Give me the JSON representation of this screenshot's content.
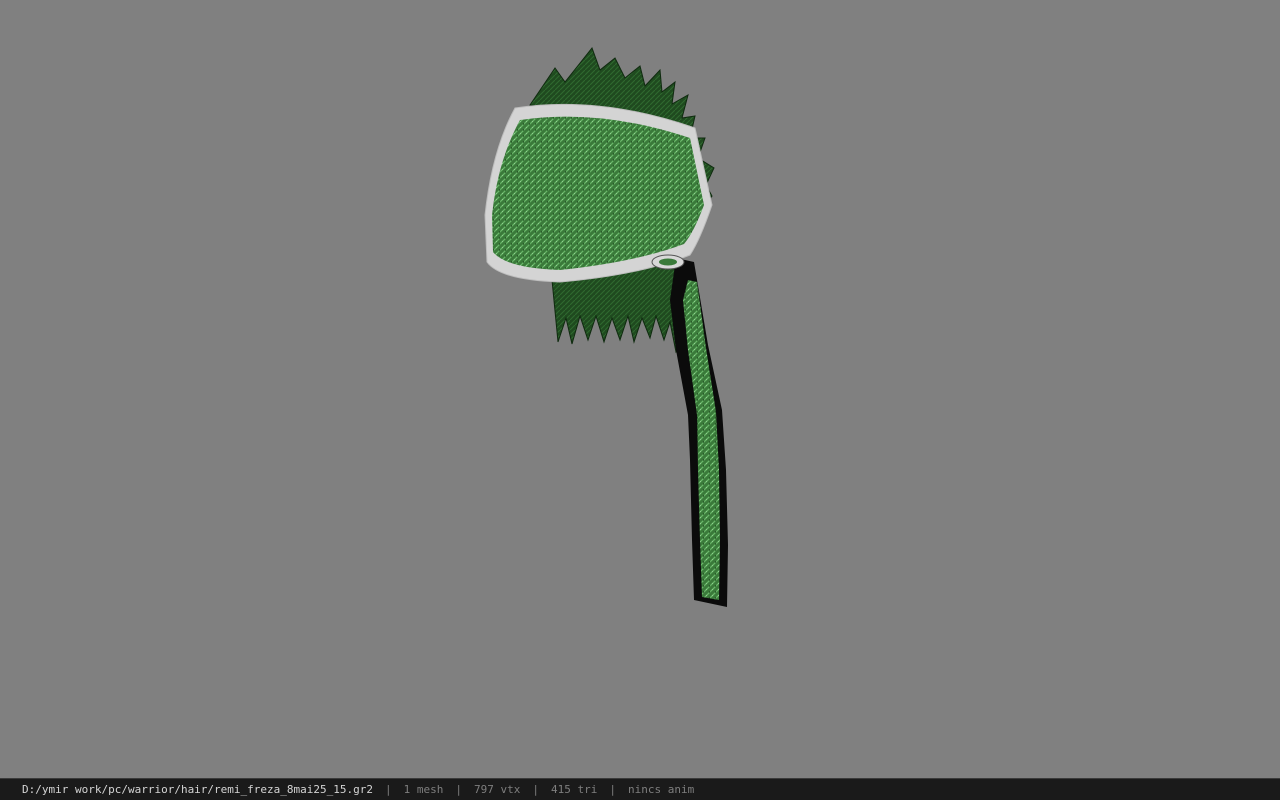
{
  "viewer": {
    "background_color": "#808080",
    "model": {
      "colors": {
        "hair_dark": "#1f4a1f",
        "hair_mid": "#3a7a3a",
        "hair_light": "#6ab86a",
        "band": "#c8c8c8",
        "outline": "#0b0b0b"
      }
    }
  },
  "status": {
    "file_path": "D:/ymir work/pc/warrior/hair/remi_freza_8mai25_15.gr2",
    "separator": "|",
    "mesh_count": "1 mesh",
    "vertex_count": "797 vtx",
    "triangle_count": "415 tri",
    "anim_status": "nincs anim"
  }
}
